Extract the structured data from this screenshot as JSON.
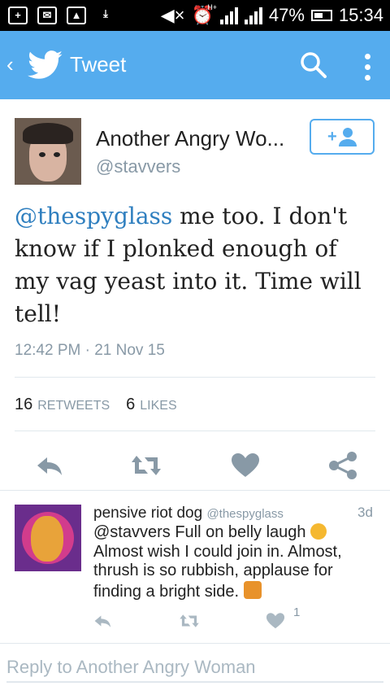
{
  "status_bar": {
    "battery": "47%",
    "time": "15:34",
    "network": "H+"
  },
  "app_bar": {
    "title": "Tweet",
    "back_icon": "chevron-left-icon",
    "logo_icon": "twitter-bird-icon",
    "search_icon": "search-icon",
    "menu_icon": "more-vertical-icon"
  },
  "tweet": {
    "author_name": "Another Angry Wo...",
    "author_handle": "@stavvers",
    "text_mention": "@thespyglass",
    "text_body": " me too. I don't know if I plonked enough of my vag yeast into it. Time will tell!",
    "timestamp": "12:42 PM · 21 Nov 15",
    "retweets_count": "16",
    "retweets_label": "RETWEETS",
    "likes_count": "6",
    "likes_label": "LIKES"
  },
  "reply_item": {
    "author_name": "pensive riot dog",
    "author_handle": "@thespyglass",
    "age": "3d",
    "text_line1": "@stavvers Full on belly laugh ",
    "text_line2": "Almost wish I could join in. Almost, thrush is so rubbish, applause for finding a bright side. ",
    "like_count": "1"
  },
  "compose": {
    "placeholder": "Reply to Another Angry Woman"
  },
  "colors": {
    "brand": "#55acee",
    "mention": "#2f7fbf",
    "muted": "#8899a6"
  }
}
